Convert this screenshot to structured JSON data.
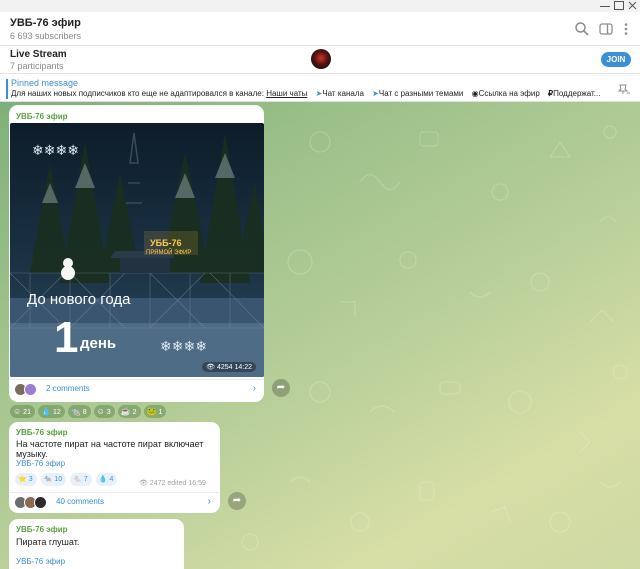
{
  "channel": {
    "title": "УВБ-76 эфир",
    "subscribers": "6 693 subscribers"
  },
  "header_icons": [
    "search-icon",
    "sidebar-toggle-icon",
    "more-vertical-icon"
  ],
  "live_stream": {
    "title": "Live Stream",
    "participants": "7 participants",
    "join_label": "JOIN"
  },
  "pinned": {
    "title": "Pinned message",
    "text": "Для наших новых подписчиков кто еще не адаптировался в канале:",
    "links": [
      "Наши чаты",
      "Чат канала",
      "Чат с разными темами",
      "Ссылка на эфир",
      "Поддержат..."
    ]
  },
  "post1": {
    "sender": "УВБ-76 эфир",
    "image_text_line1": "До нового года",
    "image_text_number": "1",
    "image_text_line2": "день",
    "neon_sign_title": "УББ-76",
    "neon_sign_subtitle": "ПРЯМОЙ ЭФИР",
    "views": "4254",
    "time": "14:22",
    "comments_label": "2 comments",
    "reactions": [
      {
        "emoji": "☺",
        "count": "21"
      },
      {
        "emoji": "💧",
        "count": "12"
      },
      {
        "emoji": "🐀",
        "count": "8"
      },
      {
        "emoji": "☺",
        "count": "3"
      },
      {
        "emoji": "☕",
        "count": "2"
      },
      {
        "emoji": "🐸",
        "count": "1"
      }
    ]
  },
  "post2": {
    "sender": "УВБ-76 эфир",
    "text": "На частоте пират на частоте пират включает музыку.",
    "signature": "УВБ-76 эфир",
    "reactions": [
      {
        "emoji": "⭐",
        "count": "3"
      },
      {
        "emoji": "🐀",
        "count": "10"
      },
      {
        "emoji": "🐁",
        "count": "7"
      },
      {
        "emoji": "💧",
        "count": "4"
      }
    ],
    "views": "2472",
    "edited_time": "edited 16:59",
    "comments_label": "40 comments"
  },
  "post3": {
    "sender": "УВБ-76 эфир",
    "text": "Пирата глушат.",
    "signature": "УВБ-76 эфир"
  }
}
